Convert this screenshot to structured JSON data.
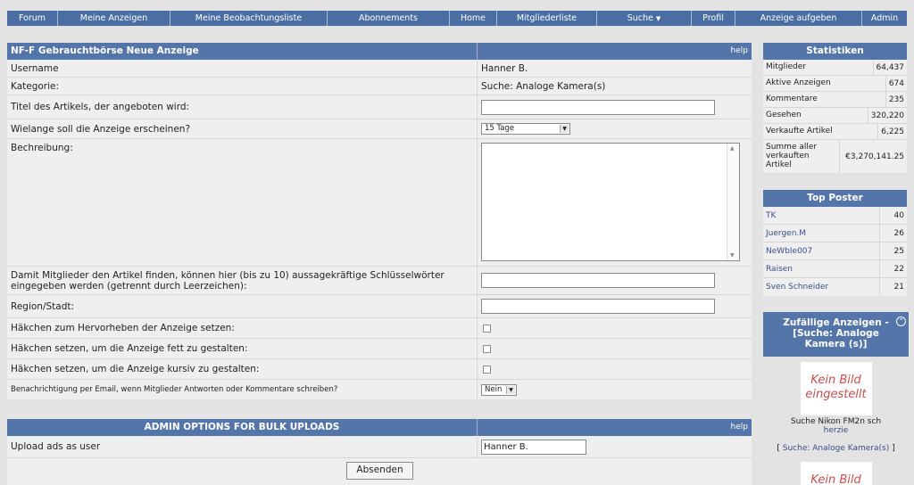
{
  "nav": {
    "items": [
      {
        "label": "Forum"
      },
      {
        "label": "Meine Anzeigen"
      },
      {
        "label": "Meine Beobachtungsliste"
      },
      {
        "label": "Abonnements"
      },
      {
        "label": "Home"
      },
      {
        "label": "Mitgliederliste"
      },
      {
        "label": "Suche"
      },
      {
        "label": "Profil"
      },
      {
        "label": "Anzeige aufgeben"
      },
      {
        "label": "Admin"
      }
    ]
  },
  "form": {
    "title": "NF-F Gebrauchtbörse Neue Anzeige",
    "help": "help",
    "username_label": "Username",
    "username_value": "Hanner B.",
    "category_label": "Kategorie:",
    "category_value": "Suche: Analoge Kamera(s)",
    "title_label": "Titel des Artikels, der angeboten wird:",
    "duration_label": "Wielange soll die Anzeige erscheinen?",
    "duration_value": "15 Tage",
    "description_label": "Bechreibung:",
    "keywords_label": "Damit Mitglieder den Artikel finden, können hier (bis zu 10) aussagekräftige Schlüsselwörter eingegeben werden (getrennt durch Leerzeichen):",
    "region_label": "Region/Stadt:",
    "highlight_label": "Häkchen zum Hervorheben der Anzeige setzen:",
    "bold_label": "Häkchen setzen, um die Anzeige fett zu gestalten:",
    "italic_label": "Häkchen setzen, um die Anzeige kursiv zu gestalten:",
    "notify_label": "Benachrichtigung per Email, wenn Mitglieder Antworten oder Kommentare schreiben?",
    "notify_value": "Nein"
  },
  "admin": {
    "title": "ADMIN OPTIONS FOR BULK UPLOADS",
    "help": "help",
    "upload_label": "Upload ads as user",
    "upload_value": "Hanner B.",
    "submit_label": "Absenden"
  },
  "stats": {
    "title": "Statistiken",
    "rows": [
      {
        "k": "Mitglieder",
        "v": "64,437"
      },
      {
        "k": "Aktive Anzeigen",
        "v": "674"
      },
      {
        "k": "Kommentare",
        "v": "235"
      },
      {
        "k": "Gesehen",
        "v": "320,220"
      },
      {
        "k": "Verkaufte Artikel",
        "v": "6,225"
      },
      {
        "k": "Summe aller verkauften Artikel",
        "v": "€3,270,141.25"
      }
    ]
  },
  "top_poster": {
    "title": "Top Poster",
    "rows": [
      {
        "k": "TK",
        "v": "40"
      },
      {
        "k": "Juergen.M",
        "v": "26"
      },
      {
        "k": "NeWbIe007",
        "v": "25"
      },
      {
        "k": "Raisen",
        "v": "22"
      },
      {
        "k": "Sven Schneider",
        "v": "21"
      }
    ]
  },
  "random": {
    "title": "Zufällige Anzeigen - [Suche: Analoge Kamera (s)]",
    "no_image": "Kein Bild eingestellt",
    "item_text": "Suche Nikon FM2n sch",
    "item_user": "herzie",
    "category_open": "[",
    "category_link": "Suche: Analoge Kamera(s)",
    "category_close": "]",
    "no_image_2": "Kein Bild"
  },
  "colors": {
    "header": "#5475a9",
    "nav": "#4a6ea4",
    "background": "#e3e3e3",
    "no_image_text": "#c0504d"
  }
}
